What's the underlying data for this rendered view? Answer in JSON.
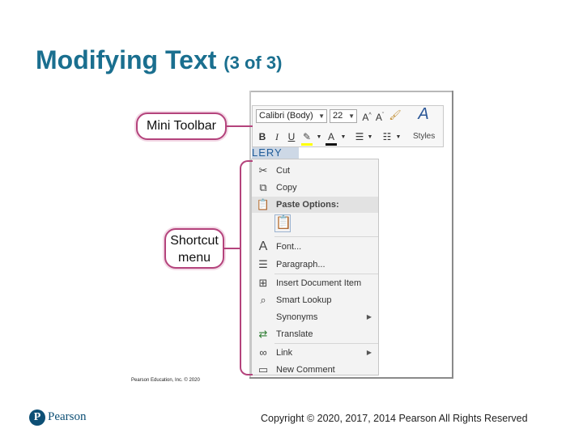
{
  "slide": {
    "title_main": "Modifying Text",
    "title_sub": "(3 of 3)"
  },
  "callouts": {
    "mini_toolbar": "Mini Toolbar",
    "shortcut_line1": "Shortcut",
    "shortcut_line2": "menu"
  },
  "mini_toolbar": {
    "font": "Calibri (Body)",
    "size": "22",
    "styles_label": "Styles"
  },
  "selected_text": "LERY",
  "context_menu": {
    "items": [
      {
        "label": "Cut",
        "icon": "scissors-icon"
      },
      {
        "label": "Copy",
        "icon": "copy-icon"
      },
      {
        "label": "Paste Options:",
        "icon": "paste-icon"
      },
      {
        "label": "",
        "icon": "paste-keep-formatting-icon"
      },
      {
        "label": "Font...",
        "icon": "font-icon"
      },
      {
        "label": "Paragraph...",
        "icon": "paragraph-icon"
      },
      {
        "label": "Insert Document Item",
        "icon": "insert-document-item-icon"
      },
      {
        "label": "Smart Lookup",
        "icon": "search-icon"
      },
      {
        "label": "Synonyms",
        "icon": ""
      },
      {
        "label": "Translate",
        "icon": "translate-icon"
      },
      {
        "label": "Link",
        "icon": "link-icon"
      },
      {
        "label": "New Comment",
        "icon": "comment-icon"
      }
    ]
  },
  "credit": "Pearson Education, Inc. © 2020",
  "footer": {
    "brand": "Pearson",
    "logo_letter": "P",
    "copyright": "Copyright © 2020, 2017, 2014 Pearson All Rights Reserved"
  },
  "colors": {
    "title": "#1a6f8f",
    "callout_border": "#b4437c",
    "brand": "#0d4f75"
  }
}
